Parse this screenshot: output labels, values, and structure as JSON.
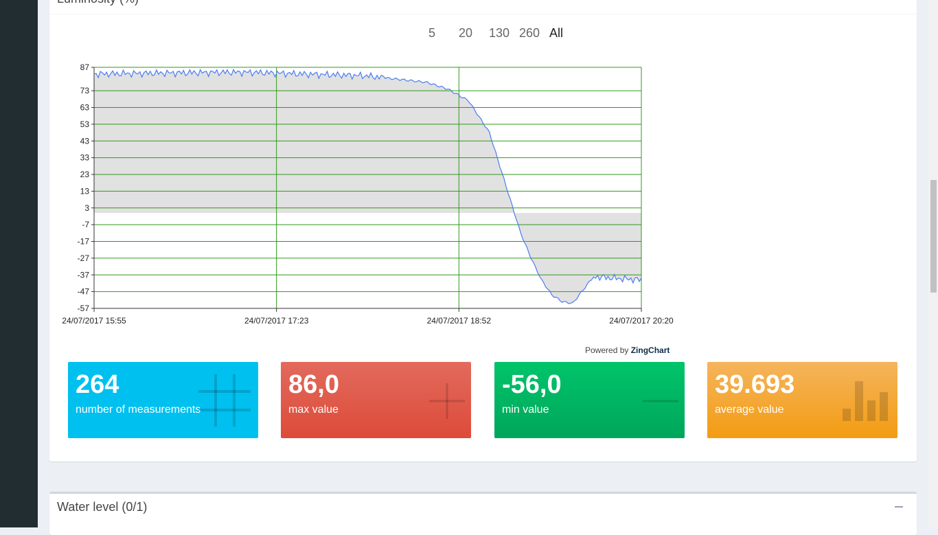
{
  "luminosity": {
    "title": "Luminosity (%)",
    "zoom_options": [
      "5",
      "20",
      "130",
      "260",
      "All"
    ],
    "powered_prefix": "Powered by",
    "powered_brand": "ZingChart",
    "chart_data": {
      "type": "area",
      "y_ticks": [
        87,
        73,
        63,
        53,
        43,
        33,
        23,
        13,
        3,
        -7,
        -17,
        -27,
        -37,
        -47,
        -57
      ],
      "x_ticks": [
        "24/07/2017 15:55",
        "24/07/2017 17:23",
        "24/07/2017 18:52",
        "24/07/2017 20:20"
      ],
      "ylim": [
        -57,
        87
      ],
      "grid": true,
      "colors": {
        "line": "#4a7cf0",
        "fill": "#dcdcdc",
        "grid": "#2e9a19"
      },
      "x": [
        0,
        60,
        75,
        100,
        130,
        160,
        170,
        180,
        190,
        195,
        200,
        205,
        210,
        215,
        220,
        225,
        230,
        240,
        250,
        263
      ],
      "y": [
        83,
        84,
        84,
        83,
        82,
        78,
        74,
        67,
        48,
        28,
        8,
        -12,
        -27,
        -40,
        -49,
        -53,
        -54,
        -38,
        -39,
        -40
      ],
      "series": [
        {
          "values": [
            83,
            84,
            84,
            83,
            82,
            78,
            74,
            67,
            48,
            28,
            8,
            -12,
            -27,
            -40,
            -49,
            -53,
            -54,
            -38,
            -39,
            -40
          ]
        }
      ]
    },
    "stats": [
      {
        "value": "264",
        "label": "number of measurements",
        "icon": "grid-icon"
      },
      {
        "value": "86,0",
        "label": "max value",
        "icon": "plus-icon"
      },
      {
        "value": "-56,0",
        "label": "min value",
        "icon": "minus-icon"
      },
      {
        "value": "39.693",
        "label": "average value",
        "icon": "bar-chart-icon"
      }
    ]
  },
  "water_level": {
    "title": "Water level (0/1)",
    "collapse_icon": "minus-icon"
  }
}
